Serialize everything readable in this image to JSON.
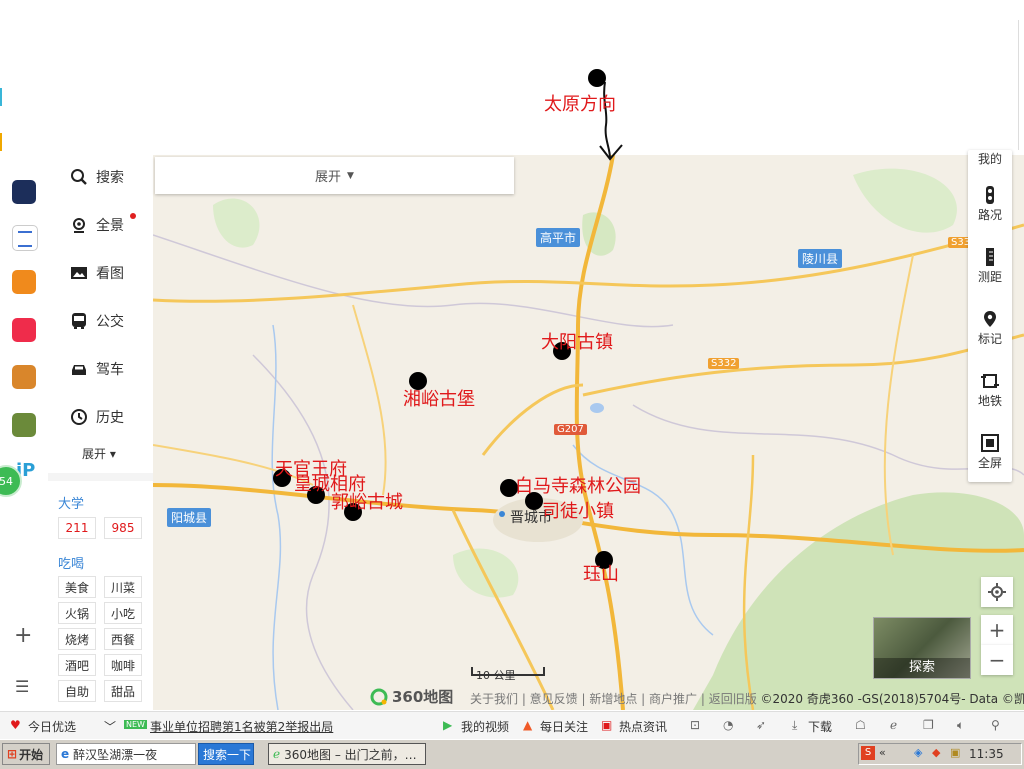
{
  "annotation": {
    "top_label": "太原方向"
  },
  "side_menu": {
    "items": [
      {
        "label": "搜索",
        "icon": "search-icon"
      },
      {
        "label": "全景",
        "icon": "panorama-icon"
      },
      {
        "label": "看图",
        "icon": "image-icon"
      },
      {
        "label": "公交",
        "icon": "bus-icon"
      },
      {
        "label": "驾车",
        "icon": "car-icon"
      },
      {
        "label": "历史",
        "icon": "clock-icon"
      }
    ],
    "expand_label": "展开",
    "section_univ": {
      "title": "大学",
      "tags": [
        "211",
        "985"
      ]
    },
    "section_food": {
      "title": "吃喝",
      "tags": [
        "美食",
        "川菜",
        "火锅",
        "小吃",
        "烧烤",
        "西餐",
        "酒吧",
        "咖啡",
        "自助",
        "甜品"
      ]
    }
  },
  "app_strip": {
    "badge": "54"
  },
  "map": {
    "expand_bar_label": "展开",
    "cities": [
      "高平市",
      "陵川县",
      "阳城县",
      "晋城市"
    ],
    "roads": [
      "S332",
      "G207",
      "S33"
    ],
    "scale": "10 公里",
    "pois": [
      "大阳古镇",
      "湘峪古堡",
      "天官王府",
      "皇城相府",
      "郭峪古城",
      "白马寺森林公园",
      "司徒小镇",
      "珏山"
    ],
    "explore_label": "探索",
    "logo": "360地图",
    "attribution_links": "关于我们 | 意见反馈 | 新增地点 | 商户推广 | 返回旧版",
    "copyright": "©2020 奇虎360 -GS(2018)5704号- Data ©凯立德"
  },
  "right_tools": [
    {
      "label": "我的",
      "icon": "user-icon"
    },
    {
      "label": "路况",
      "icon": "traffic-light-icon"
    },
    {
      "label": "测距",
      "icon": "ruler-icon"
    },
    {
      "label": "标记",
      "icon": "pin-icon"
    },
    {
      "label": "地铁",
      "icon": "subway-icon"
    },
    {
      "label": "全屏",
      "icon": "fullscreen-icon"
    }
  ],
  "status_bar": {
    "today": "今日优选",
    "new_badge": "NEW",
    "news": "事业单位招聘第1名被第2举报出局",
    "video": "我的视频",
    "daily": "每日关注",
    "hot": "热点资讯",
    "download": "下载"
  },
  "taskbar": {
    "start": "开始",
    "search_text": "醉汉坠湖漂一夜",
    "search_btn": "搜索一下",
    "window_title": "360地图 – 出门之前，…",
    "time": "11:35"
  }
}
